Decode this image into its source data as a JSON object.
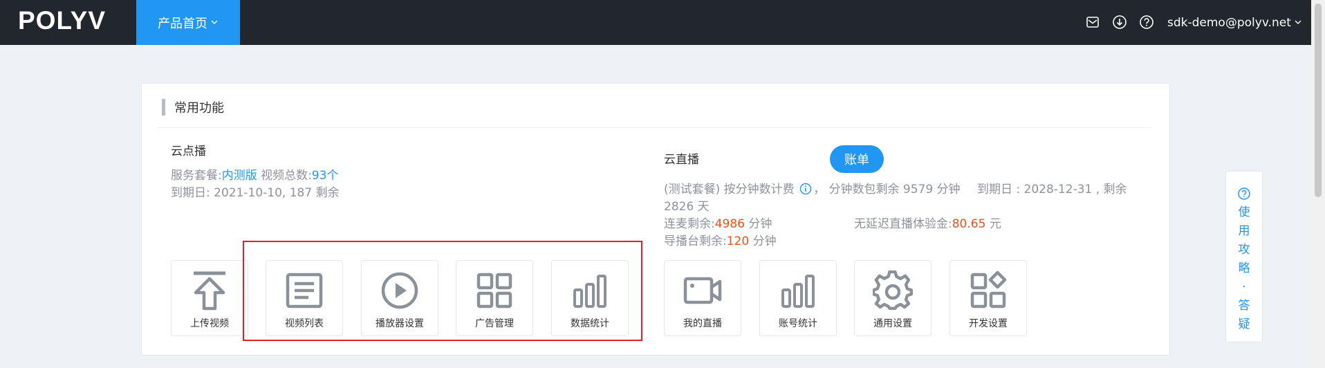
{
  "header": {
    "logo": "POLYV",
    "nav_active_label": "产品首页",
    "user_email": "sdk-demo@polyv.net",
    "icons": [
      "mail-icon",
      "download-icon",
      "help-circle-icon"
    ]
  },
  "card": {
    "title": "常用功能",
    "vod": {
      "title": "云点播",
      "package_label": "服务套餐:",
      "package_value": "内测版",
      "video_total_label": "视频总数:",
      "video_total_value": "93个",
      "expiry": "到期日: 2021-10-10, 187 剩余"
    },
    "live": {
      "title": "云直播",
      "bill_button": "账单",
      "billing_text": "(测试套餐) 按分钟数计费",
      "minutes_remaining": "，  分钟数包剩余 9579 分钟",
      "expiry_line1": "到期日 : 2028-12-31 , 剩余",
      "expiry_line2": "2826 天",
      "lianmai_label": "连麦剩余:",
      "lianmai_value": "4986",
      "lianmai_unit": "分钟",
      "nodelay_label": "无延迟直播体验金:",
      "nodelay_value": "80.65",
      "nodelay_unit": "元",
      "director_label": "导播台剩余:",
      "director_value": "120",
      "director_unit": "分钟"
    },
    "tiles": [
      {
        "label": "上传视频",
        "icon": "upload-icon"
      },
      {
        "label": "视频列表",
        "icon": "list-icon"
      },
      {
        "label": "播放器设置",
        "icon": "play-circle-icon"
      },
      {
        "label": "广告管理",
        "icon": "grid-icon"
      },
      {
        "label": "数据统计",
        "icon": "bar-chart-icon"
      },
      {
        "label": "我的直播",
        "icon": "video-camera-icon"
      },
      {
        "label": "账号统计",
        "icon": "bar-chart-icon"
      },
      {
        "label": "通用设置",
        "icon": "gear-icon"
      },
      {
        "label": "开发设置",
        "icon": "apps-icon"
      }
    ]
  },
  "help_widget": {
    "text_lines": [
      "使",
      "用",
      "攻",
      "略",
      "·",
      "答",
      "疑"
    ]
  },
  "colors": {
    "topbar": "#22272e",
    "accent": "#2196f3",
    "highlight_red": "#f04f1c",
    "annotation_box": "#e52020",
    "icon_gray": "#8a9199"
  }
}
